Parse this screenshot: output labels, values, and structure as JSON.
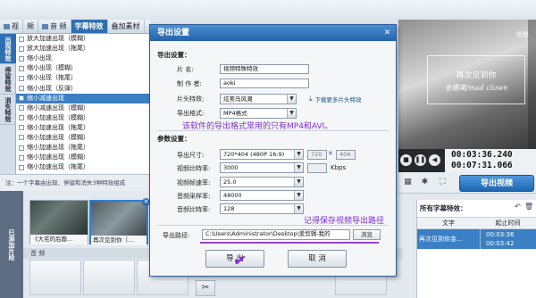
{
  "top_tabs": [
    {
      "label": "视",
      "icon": "video-icon"
    },
    {
      "label": "频",
      "icon": ""
    },
    {
      "label": "音 频",
      "icon": "music-icon"
    },
    {
      "label": "字幕特效",
      "icon": ""
    },
    {
      "label": "叠加素材",
      "icon": ""
    }
  ],
  "left_tabs": [
    "出现特效",
    "停留特效",
    "消失特效"
  ],
  "effects": [
    "放大加速出现（模糊）",
    "放大加速出现（拖尾）",
    "缩小出现",
    "缩小出现（模糊）",
    "缩小出现（拖尾）",
    "缩小出现（反弹）",
    "缩小减速出现",
    "缩小减速出现（模糊）",
    "缩小加速出现（模糊）",
    "缩小加速出现（拖尾）",
    "缩小加速出现（模糊）",
    "缩小加速出现（拖尾）",
    "缩小加速出现（模糊）",
    "缩小加速出现（拖尾）"
  ],
  "selected_effect_index": 6,
  "hint": "注：一个字幕由出现、停留和消失3种特效组成",
  "clip_side_label": "已添加片段",
  "clips": [
    {
      "caption": "《大宅的后裔…",
      "active": false
    },
    {
      "caption": "再次见到你（…",
      "active": true
    }
  ],
  "audio_label": "音 频",
  "preview": {
    "logo": "优酷",
    "caption_line1": "再次见到你",
    "caption_line2": "金娜英/mad clown"
  },
  "player": {
    "current_time": "00:03:36.240",
    "total_time": "00:07:31.066"
  },
  "export_button": "导出视频",
  "subtitle_panel": {
    "title": "所有字幕特效：",
    "col_text": "文字",
    "col_time": "起止时间",
    "rows": [
      {
        "text": "再次见到你金…",
        "start": "00:03:36",
        "end": "00:03:42"
      }
    ]
  },
  "dialog": {
    "title": "导出设置",
    "close": "✕",
    "export_section": "导出设置：",
    "name_label": "片    名:",
    "name_value": "视频特殊特效",
    "author_label": "制 作 者:",
    "author_value": "aoki",
    "header_effect_label": "片头特效:",
    "header_effect_value": "炫美马风潮",
    "more_link": "下载更多片头特效",
    "format_label": "导出格式:",
    "format_value": "MP4格式",
    "note_format": "该软件的导出格式常用的只有MP4和AVI。",
    "params_section": "参数设置：",
    "size_label": "导出尺寸:",
    "size_value": "720*404 (480P 16:9)",
    "width_value": "720",
    "height_value": "404",
    "x_mark": "✕",
    "vbitrate_label": "视频比特率:",
    "vbitrate_value": "3000",
    "vbitrate_unit": "Kbps",
    "framerate_label": "视频帧速率:",
    "framerate_value": "25.0",
    "samplerate_label": "音频采样率:",
    "samplerate_value": "48000",
    "abitrate_label": "音频比特率:",
    "abitrate_value": "128",
    "note_path": "记得保存视频导出路径",
    "path_label": "导出路径:",
    "path_value": "C:\\Users\\Administrator\\Desktop\\爱剪辑-我的",
    "browse": "浏览",
    "export_btn": "导 出",
    "cancel_btn": "取 消"
  }
}
